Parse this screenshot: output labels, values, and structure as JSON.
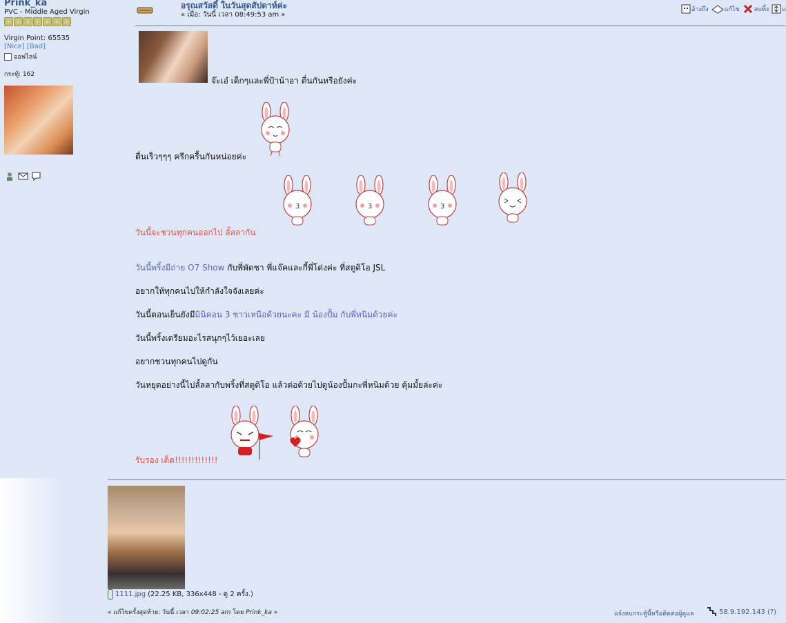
{
  "poster": {
    "name": "Prink_ka",
    "rank": "PVC - Middle Aged Virgin",
    "points": "Virgin Point: 65535",
    "karma_nice": "[Nice]",
    "karma_bad": "[Bad]",
    "status": "ออฟไลน์",
    "post_count": "กระทู้: 162",
    "star_count": 7
  },
  "post": {
    "subject": "อรุณสวัสดิ์ ในวันสุดสัปดาห์ค่ะ",
    "date": "« เมื่อ: วันนี้ เวลา 08:49:53 am »"
  },
  "actions": {
    "quote": "อ้างถึง",
    "edit": "แก้ไข",
    "delete": "ลบทิ้ง",
    "split": "แ"
  },
  "body": {
    "line1": "จ๊ะเอ๋ เด็กๆและพี่ป้าน้าอา ตื่นกันหรือยังค่ะ",
    "line2": "ตื่นเร็วๆๆๆ ครีกครื้นกันหน่อยค่ะ",
    "line3": "วันนี้จะชวนทุกคนออกไป ลั้ลลากัน",
    "line4_blue": "วันนี้พริ้งมีถ่าย O7 Show",
    "line4_black": " กับพี่พัดชา พี่แจ๊คและกี้พี่โด่งค่ะ ที่สตูดิโอ JSL",
    "line5": "อยากให้ทุกคนไปให้กำลังใจจังเลยค่ะ",
    "line6_black": "วันนี้ตอนเย็นยังมี",
    "line6_blue": "มินิคอน 3 ชาวเหนือด้วยนะคะ มี น้องปั้ม กับพี่หนิมด้วยค่ะ",
    "line7": "วันนี้พริ้งเตรียมอะไรสนุกๆไว้เยอะเลย",
    "line8": "อยากชวนทุกคนไปดูกัน",
    "line9": "วันหยุดอย่างนี้ไปลั้ลลากับพริ้งที่สตูดิโอ แล้วต่อด้วยไปดูน้องปั้มกะพี่หนิมด้วย คุ้มมั้ยล่ะค่ะ",
    "line10": "รับรอง เด็ด!!!!!!!!!!!!!"
  },
  "attachment": {
    "name": "1111.jpg",
    "info": " (22.25 KB, 336x448 - ดู 2 ครั้ง.)"
  },
  "footer": {
    "modified_prefix": "« แก้ไขครั้งสุดท้าย: วันนี้ เวลา ",
    "modified_time": "09:02:25 am",
    "modified_by": " โดย ",
    "modified_user": "Prink_ka",
    "modified_suffix": " »",
    "report": "แจ้งลบกระทู้นี้หรือติดต่อผู้ดูแล",
    "ip": "58.9.192.143 (?)"
  },
  "colors": {
    "background": "#dde7f5",
    "link": "#33598c",
    "red_text": "#e1504b",
    "blue_text": "#5b64c2"
  }
}
